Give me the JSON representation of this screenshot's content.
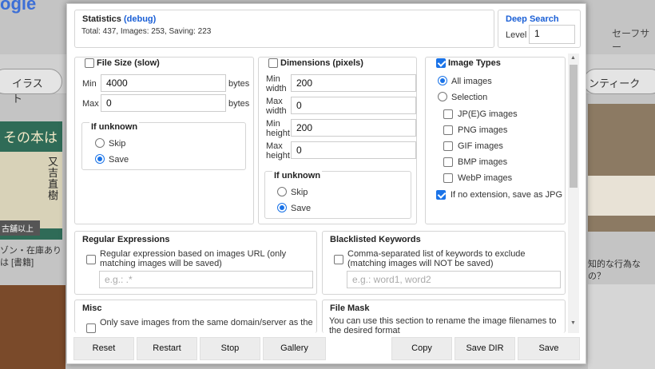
{
  "background": {
    "logo": "ogle",
    "safe_search": "セーフサー",
    "chips": [
      "イラスト",
      "ンティーク"
    ],
    "captions": [
      "ゾン・在庫あり",
      "は [書籍]",
      "知的な行為なの？"
    ],
    "book_title": "その本は",
    "book_sub": "又吉直樹",
    "book_badge": "古舗以上"
  },
  "stats": {
    "title": "Statistics",
    "debug": "(debug)",
    "summary": "Total: 437, Images: 253, Saving: 223"
  },
  "deep_search": {
    "title": "Deep Search",
    "level_label": "Level",
    "level_value": "1"
  },
  "file_size": {
    "title": "File Size (slow)",
    "min_label": "Min",
    "min_value": "4000",
    "max_label": "Max",
    "max_value": "0",
    "unit": "bytes",
    "unknown_title": "If unknown",
    "skip": "Skip",
    "save": "Save"
  },
  "dimensions": {
    "title": "Dimensions (pixels)",
    "min_width": "Min\nwidth",
    "min_width_value": "200",
    "max_width": "Max\nwidth",
    "max_width_value": "0",
    "min_height": "Min\nheight",
    "min_height_value": "200",
    "max_height": "Max\nheight",
    "max_height_value": "0",
    "unknown_title": "If unknown",
    "skip": "Skip",
    "save": "Save"
  },
  "image_types": {
    "title": "Image Types",
    "all": "All images",
    "selection": "Selection",
    "types": [
      "JP(E)G images",
      "PNG images",
      "GIF images",
      "BMP images",
      "WebP images"
    ],
    "no_ext": "If no extension, save as JPG"
  },
  "regex": {
    "title": "Regular Expressions",
    "desc": "Regular expression based on images URL (only matching images will be saved)",
    "placeholder": "e.g.: .*"
  },
  "blacklist": {
    "title": "Blacklisted Keywords",
    "desc": "Comma-separated list of keywords to exclude (matching images will NOT be saved)",
    "placeholder": "e.g.: word1, word2"
  },
  "misc": {
    "title": "Misc",
    "option": "Only save images from the same domain/server as the"
  },
  "file_mask": {
    "title": "File Mask",
    "desc": "You can use this section to rename the image filenames to the desired format"
  },
  "buttons": {
    "reset": "Reset",
    "restart": "Restart",
    "stop": "Stop",
    "gallery": "Gallery",
    "copy": "Copy",
    "save_dir": "Save DIR",
    "save": "Save"
  },
  "colors": {
    "accent": "#1a73e8",
    "link": "#1a5fd6"
  }
}
